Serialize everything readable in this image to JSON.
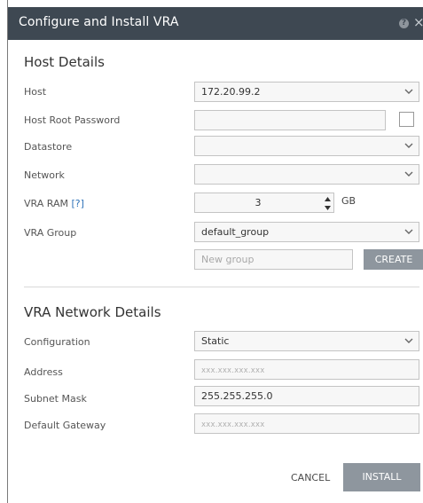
{
  "dialog": {
    "title": "Configure and Install VRA",
    "help_icon": "?",
    "close_icon": "×"
  },
  "host_details": {
    "heading": "Host Details",
    "host": {
      "label": "Host",
      "value": "172.20.99.2"
    },
    "root_password": {
      "label": "Host Root Password",
      "value": ""
    },
    "datastore": {
      "label": "Datastore",
      "value": ""
    },
    "network": {
      "label": "Network",
      "value": ""
    },
    "vra_ram": {
      "label": "VRA RAM",
      "help": "[?]",
      "value": "3",
      "unit": "GB"
    },
    "vra_group": {
      "label": "VRA Group",
      "value": "default_group"
    },
    "new_group": {
      "placeholder": "New group"
    },
    "create_label": "CREATE"
  },
  "network_details": {
    "heading": "VRA Network Details",
    "configuration": {
      "label": "Configuration",
      "value": "Static"
    },
    "address": {
      "label": "Address",
      "placeholder": "xxx.xxx.xxx.xxx"
    },
    "subnet_mask": {
      "label": "Subnet Mask",
      "value": "255.255.255.0"
    },
    "default_gateway": {
      "label": "Default Gateway",
      "placeholder": "xxx.xxx.xxx.xxx"
    }
  },
  "footer": {
    "cancel_label": "CANCEL",
    "install_label": "INSTALL"
  }
}
